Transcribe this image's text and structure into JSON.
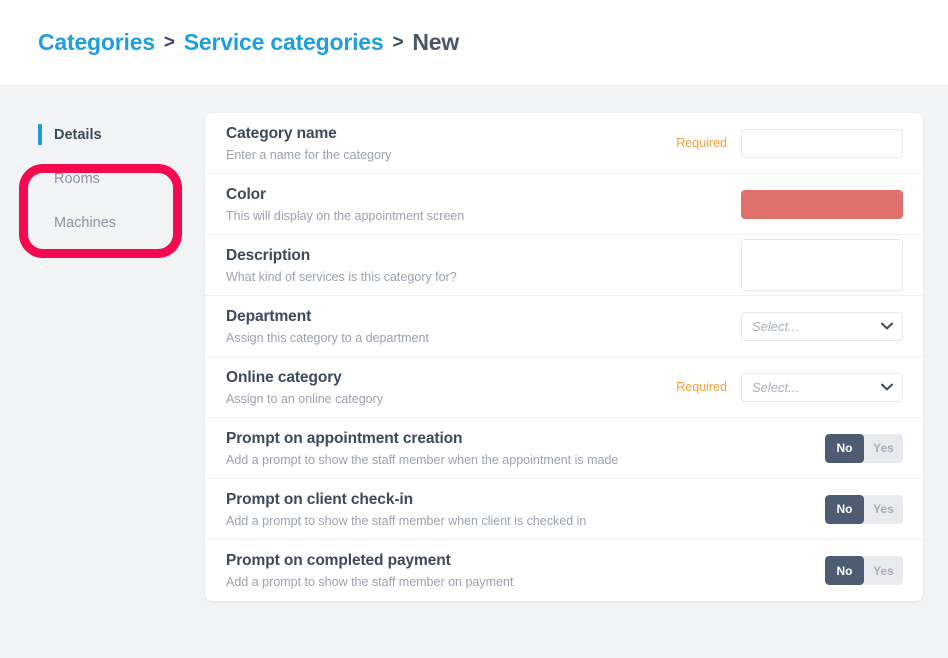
{
  "breadcrumb": {
    "items": [
      {
        "label": "Categories",
        "current": false
      },
      {
        "label": "Service categories",
        "current": false
      },
      {
        "label": "New",
        "current": true
      }
    ],
    "separator": ">"
  },
  "sidebar": {
    "items": [
      {
        "label": "Details",
        "active": true
      },
      {
        "label": "Rooms",
        "active": false
      },
      {
        "label": "Machines",
        "active": false
      }
    ],
    "annotation_color": "#f5094f",
    "active_bar_color": "#1f9cd7"
  },
  "form": {
    "rows": [
      {
        "label": "Category name",
        "description": "Enter a name for the category",
        "required_label": "Required",
        "control": "text",
        "value": "",
        "placeholder": ""
      },
      {
        "label": "Color",
        "description": "This will display on the appointment screen",
        "required_label": "",
        "control": "color",
        "value": "#e0706b"
      },
      {
        "label": "Description",
        "description": "What kind of services is this category for?",
        "required_label": "",
        "control": "textarea",
        "value": "",
        "placeholder": ""
      },
      {
        "label": "Department",
        "description": "Assign this category to a department",
        "required_label": "",
        "control": "select",
        "value": "Select..."
      },
      {
        "label": "Online category",
        "description": "Assign to an online category",
        "required_label": "Required",
        "control": "select",
        "value": "Select..."
      },
      {
        "label": "Prompt on appointment creation",
        "description": "Add a prompt to show the staff member when the appointment is made",
        "required_label": "",
        "control": "toggle",
        "toggle_on": "No",
        "toggle_off": "Yes",
        "selected": "No"
      },
      {
        "label": "Prompt on client check-in",
        "description": "Add a prompt to show the staff member when client is checked in",
        "required_label": "",
        "control": "toggle",
        "toggle_on": "No",
        "toggle_off": "Yes",
        "selected": "No"
      },
      {
        "label": "Prompt on completed payment",
        "description": "Add a prompt to show the staff member on payment",
        "required_label": "",
        "control": "toggle",
        "toggle_on": "No",
        "toggle_off": "Yes",
        "selected": "No"
      }
    ]
  },
  "colors": {
    "accent_blue": "#1fa0dd",
    "required_orange": "#f5a03c",
    "toggle_active": "#4d5b73",
    "annotation": "#f5094f"
  }
}
